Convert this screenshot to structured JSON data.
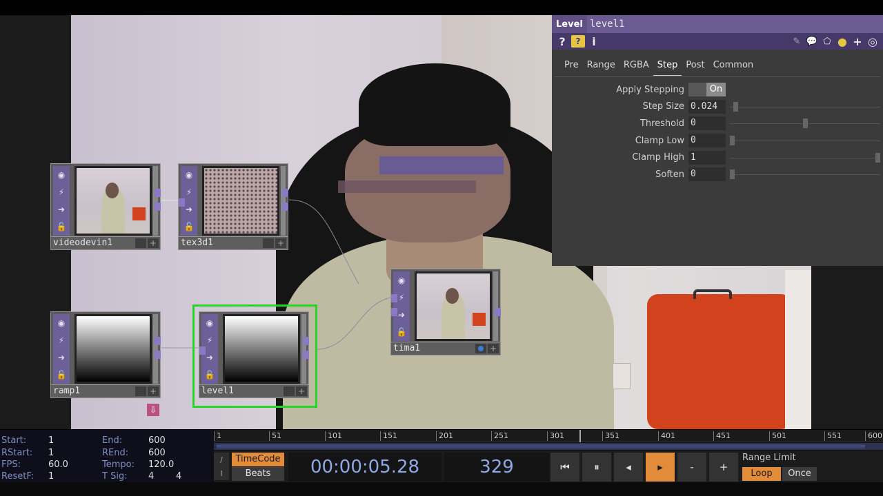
{
  "param_panel": {
    "op_type": "Level",
    "op_name": "level1",
    "icons_left": [
      "help-icon",
      "python-help-icon",
      "info-icon"
    ],
    "icons_right": [
      "edit-icon",
      "comment-icon",
      "clone-icon",
      "python-icon",
      "plus-icon",
      "target-icon"
    ],
    "tabs": [
      "Pre",
      "Range",
      "RGBA",
      "Step",
      "Post",
      "Common"
    ],
    "active_tab": "Step",
    "params": [
      {
        "label": "Apply Stepping",
        "value": "On",
        "kind": "toggle"
      },
      {
        "label": "Step Size",
        "value": "0.024",
        "slider": 0.024
      },
      {
        "label": "Threshold",
        "value": "0",
        "slider": 0.5
      },
      {
        "label": "Clamp Low",
        "value": "0",
        "slider": 0.0
      },
      {
        "label": "Clamp High",
        "value": "1",
        "slider": 1.0
      },
      {
        "label": "Soften",
        "value": "0",
        "slider": 0.0
      }
    ]
  },
  "nodes": [
    {
      "name": "videodevin1",
      "preview": "camera"
    },
    {
      "name": "tex3d1",
      "preview": "texture"
    },
    {
      "name": "ramp1",
      "preview": "gradient"
    },
    {
      "name": "level1",
      "preview": "gradient",
      "selected": true
    },
    {
      "name": "tima1",
      "preview": "camera"
    }
  ],
  "timeline": {
    "info": {
      "start_label": "Start:",
      "start": "1",
      "rstart_label": "RStart:",
      "rstart": "1",
      "fps_label": "FPS:",
      "fps": "60.0",
      "resetf_label": "ResetF:",
      "resetf": "1",
      "end_label": "End:",
      "end": "600",
      "rend_label": "REnd:",
      "rend": "600",
      "tempo_label": "Tempo:",
      "tempo": "120.0",
      "tsig_label": "T Sig:",
      "tsig_num": "4",
      "tsig_den": "4"
    },
    "ruler_ticks": [
      "1",
      "51",
      "101",
      "151",
      "201",
      "251",
      "301",
      "351",
      "401",
      "451",
      "501",
      "551",
      "600"
    ],
    "mode_timecode": "TimeCode",
    "mode_beats": "Beats",
    "clock": "00:00:05.28",
    "frame": "329",
    "transport": [
      "⏮",
      "⏸",
      "◂",
      "▸",
      "-",
      "+"
    ],
    "range_limit_label": "Range Limit",
    "loop_label": "Loop",
    "once_label": "Once"
  },
  "colors": {
    "accent": "#e28b3b",
    "op_purple": "#6d5f97",
    "selection": "#27d427",
    "clock_text": "#8fa7e6"
  }
}
